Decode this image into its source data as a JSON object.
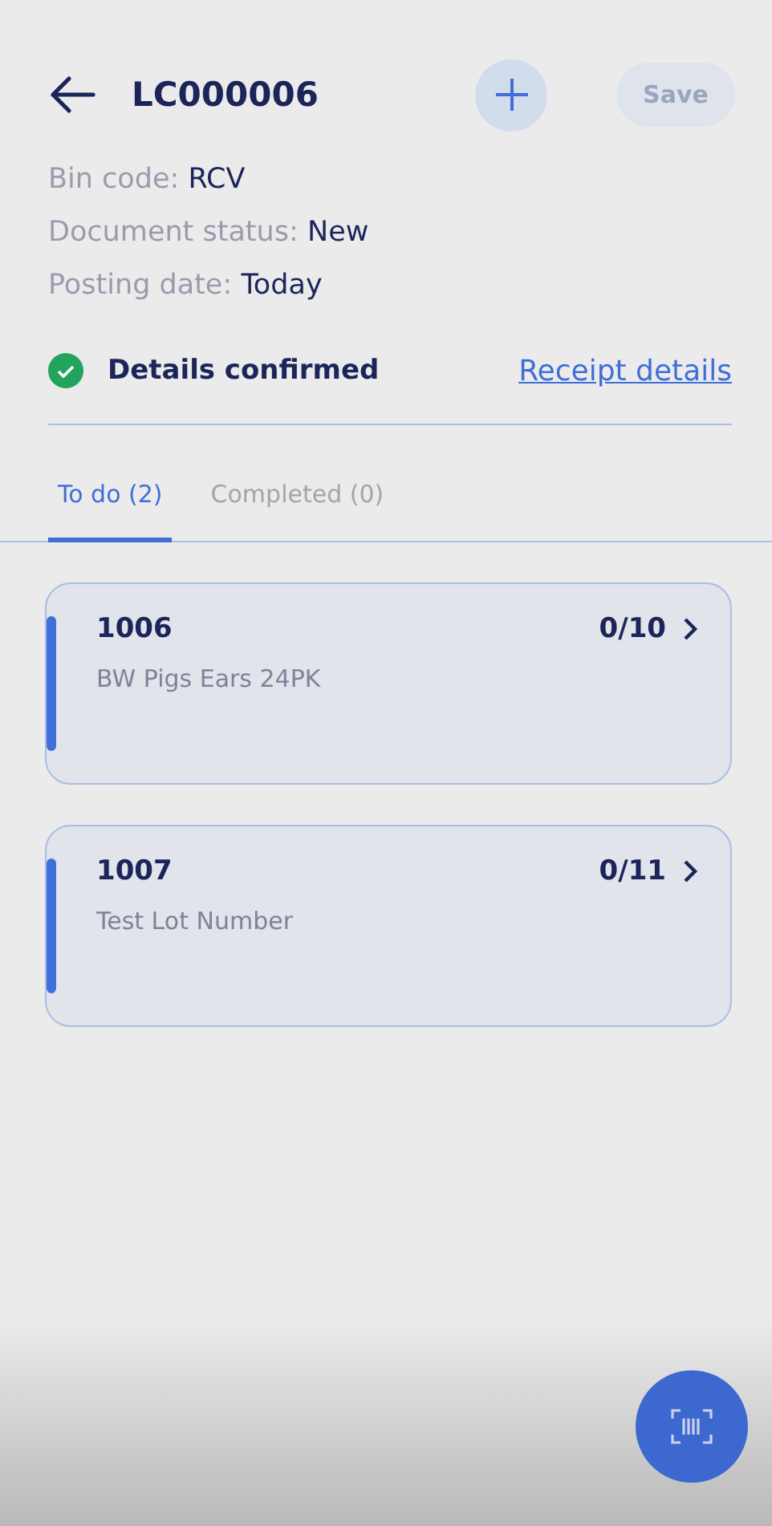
{
  "header": {
    "title": "LC000006",
    "save": {
      "label": "Save",
      "disabled": true
    }
  },
  "details": [
    {
      "label": "Bin code:",
      "value": "RCV"
    },
    {
      "label": "Document status:",
      "value": "New"
    },
    {
      "label": "Posting date:",
      "value": "Today"
    }
  ],
  "confirmation": {
    "text": "Details confirmed",
    "confirmed": true,
    "link": "Receipt details"
  },
  "tabs": [
    {
      "label": "To do (2)",
      "selected": true
    },
    {
      "label": "Completed (0)",
      "selected": false
    }
  ],
  "items": [
    {
      "code": "1006",
      "description": "BW Pigs Ears 24PK",
      "count": "0/10"
    },
    {
      "code": "1007",
      "description": "Test Lot Number",
      "count": "0/11"
    }
  ]
}
